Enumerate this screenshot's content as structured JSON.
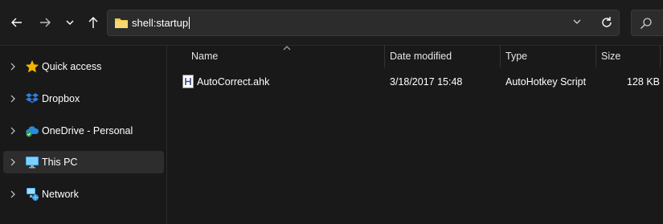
{
  "toolbar": {
    "back_icon": "arrow-left-icon",
    "forward_icon": "arrow-right-icon",
    "recent_icon": "chevron-down-icon",
    "up_icon": "arrow-up-icon",
    "address_value": "shell:startup",
    "refresh_icon": "refresh-icon",
    "search_icon": "search-icon"
  },
  "sidebar": {
    "items": [
      {
        "label": "Quick access",
        "icon": "star-icon"
      },
      {
        "label": "Dropbox",
        "icon": "dropbox-icon"
      },
      {
        "label": "OneDrive - Personal",
        "icon": "onedrive-icon"
      },
      {
        "label": "This PC",
        "icon": "monitor-icon",
        "selected": true
      },
      {
        "label": "Network",
        "icon": "network-icon"
      }
    ]
  },
  "columns": {
    "name": "Name",
    "date_modified": "Date modified",
    "type": "Type",
    "size": "Size"
  },
  "files": [
    {
      "name": "AutoCorrect.ahk",
      "date_modified": "3/18/2017 15:48",
      "type": "AutoHotkey Script",
      "size": "128 KB",
      "icon": "ahk-file-icon"
    }
  ],
  "colors": {
    "background": "#191919",
    "selected": "#2d2d2d",
    "folder": "#f2c94c",
    "star": "#f5b400",
    "dropbox": "#2f7de1",
    "onedrive": "#2b8ad6"
  }
}
